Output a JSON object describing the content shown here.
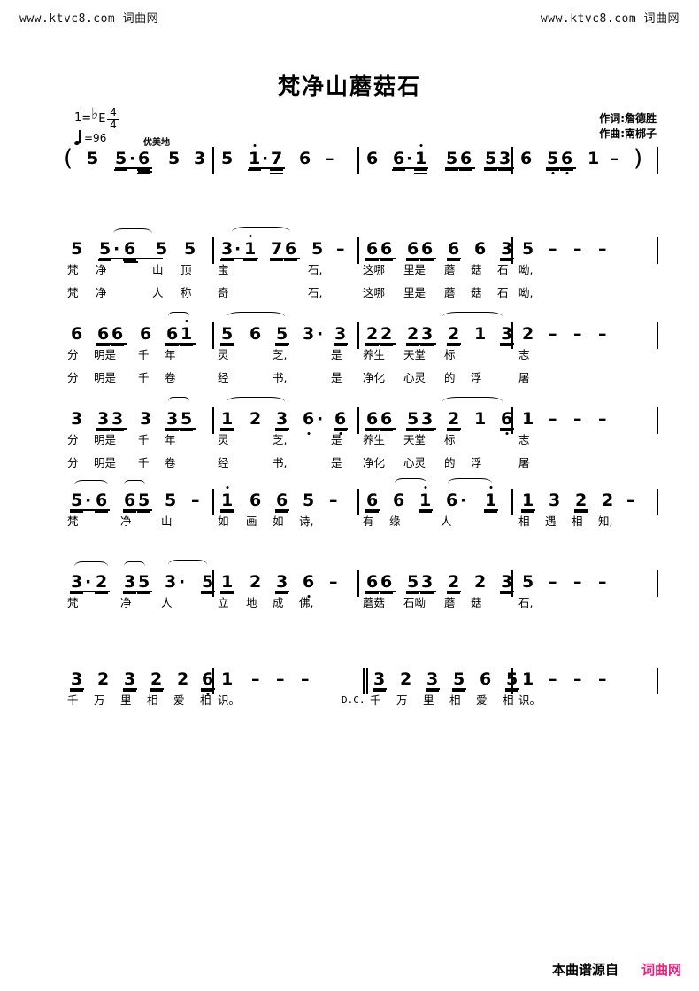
{
  "watermark": {
    "left": "www.ktvc8.com 词曲网",
    "right": "www.ktvc8.com 词曲网"
  },
  "title": "梵净山蘑菇石",
  "credits": {
    "lyricist": "作词:詹德胜",
    "composer": "作曲:南梆子"
  },
  "header": {
    "key_label": "1=",
    "flat": "♭",
    "key_name": "E",
    "time_top": "4",
    "time_bottom": "4",
    "tempo_eq": "=96",
    "expression": "优美地"
  },
  "footer": {
    "source_text": "本曲谱源自",
    "site_text": "词曲网",
    "site_color": "#ef1f7a"
  },
  "score": {
    "lines": [
      {
        "id": "intro",
        "open_paren": "(",
        "close_paren": ")",
        "measures": [
          {
            "notes": "5  5·6  5  3"
          },
          {
            "notes": "5  1̇·7  6  –"
          },
          {
            "notes": "6  6·1̇  56  53"
          },
          {
            "notes": "6  5̣6̣  1  –"
          }
        ]
      },
      {
        "id": "line2",
        "measures": [
          {
            "notes": "5  5·6  5  5"
          },
          {
            "notes": "3·1̇  76  5  –"
          },
          {
            "notes": "66 66 6 6 3"
          },
          {
            "notes": "5  –  –  –"
          }
        ],
        "lyrics_1": [
          "梵",
          "净",
          "山",
          "顶",
          "宝",
          "石,",
          "这哪",
          "里是",
          "蘑",
          "菇",
          "石",
          "呦,"
        ],
        "lyrics_2": [
          "梵",
          "净",
          "人",
          "称",
          "奇",
          "石,",
          "这哪",
          "里是",
          "蘑",
          "菇",
          "石",
          "呦,"
        ]
      },
      {
        "id": "line3",
        "measures": [
          {
            "notes": "6  66  6  61̇"
          },
          {
            "notes": "5  6  5  3·  3"
          },
          {
            "notes": "22 23 2 1 3"
          },
          {
            "notes": "2  –  –  –"
          }
        ],
        "lyrics_1": [
          "分",
          "明是",
          "千",
          "年",
          "灵",
          "芝,",
          "是",
          "养生",
          "天堂",
          "标",
          "",
          "志"
        ],
        "lyrics_2": [
          "分",
          "明是",
          "千",
          "卷",
          "经",
          "书,",
          "是",
          "净化",
          "心灵",
          "的",
          "浮",
          "屠"
        ]
      },
      {
        "id": "line4",
        "measures": [
          {
            "notes": "3  33  3  35"
          },
          {
            "notes": "1  2  3  6̣·  6̣"
          },
          {
            "notes": "66 53 2 1 6̣"
          },
          {
            "notes": "1  –  –  –"
          }
        ],
        "lyrics_1": [
          "分",
          "明是",
          "千",
          "年",
          "灵",
          "芝,",
          "是",
          "养生",
          "天堂",
          "标",
          "",
          "志"
        ],
        "lyrics_2": [
          "分",
          "明是",
          "千",
          "卷",
          "经",
          "书,",
          "是",
          "净化",
          "心灵",
          "的",
          "浮",
          "屠"
        ]
      },
      {
        "id": "line5",
        "measures": [
          {
            "notes": "5·6  65  5  –"
          },
          {
            "notes": "1̇  6  6  5  –"
          },
          {
            "notes": "6  6  1̇  6·  1̇"
          },
          {
            "notes": "1  3  2  2  –"
          }
        ],
        "lyrics_1": [
          "梵",
          "净",
          "山",
          "如",
          "画",
          "如",
          "诗,",
          "有",
          "缘",
          "人",
          "相",
          "遇",
          "相",
          "知,"
        ]
      },
      {
        "id": "line6",
        "measures": [
          {
            "notes": "3·2  35  3·  5"
          },
          {
            "notes": "1  2  3  6̣  –"
          },
          {
            "notes": "66 53 2 2 3"
          },
          {
            "notes": "5  –  –  –"
          }
        ],
        "lyrics_1": [
          "梵",
          "净",
          "人",
          "立",
          "地",
          "成",
          "佛,",
          "蘑菇",
          "石呦",
          "蘑",
          "菇",
          "石,"
        ]
      },
      {
        "id": "line7",
        "dc_mark": "D.C.",
        "measures": [
          {
            "notes": "3 2 3 2 2 6̣"
          },
          {
            "notes": "1  –  –  –"
          },
          {
            "notes": "3 2 3 5 6 5"
          },
          {
            "notes": "1  –  –  –"
          }
        ],
        "lyrics_1": [
          "千",
          "万",
          "里",
          "相",
          "爱",
          "相",
          "识。",
          "千",
          "万",
          "里",
          "相",
          "爱",
          "相",
          "识。"
        ]
      }
    ]
  }
}
